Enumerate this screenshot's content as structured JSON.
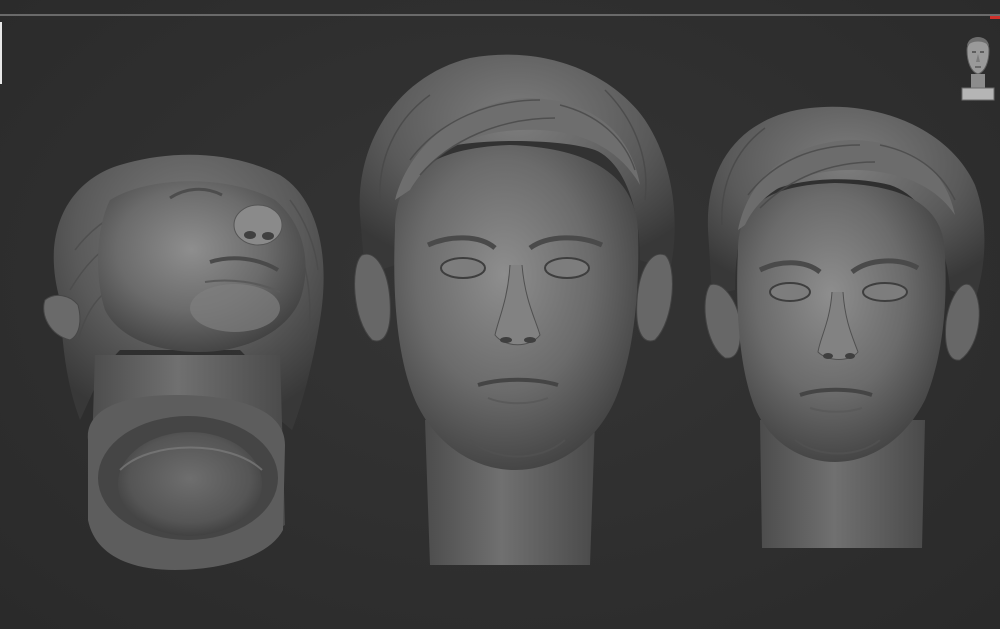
{
  "viewport": {
    "background_color": "#2e2e2e",
    "models": [
      {
        "name": "head-bottom-view",
        "view": "underside"
      },
      {
        "name": "head-front-view",
        "view": "front"
      },
      {
        "name": "head-three-quarter-view",
        "view": "three-quarter"
      }
    ]
  },
  "navigation_widget": {
    "icon": "orientation-head-icon"
  },
  "accent_colors": {
    "indicator": "#d0302a",
    "clay": "#7a7a7a"
  }
}
